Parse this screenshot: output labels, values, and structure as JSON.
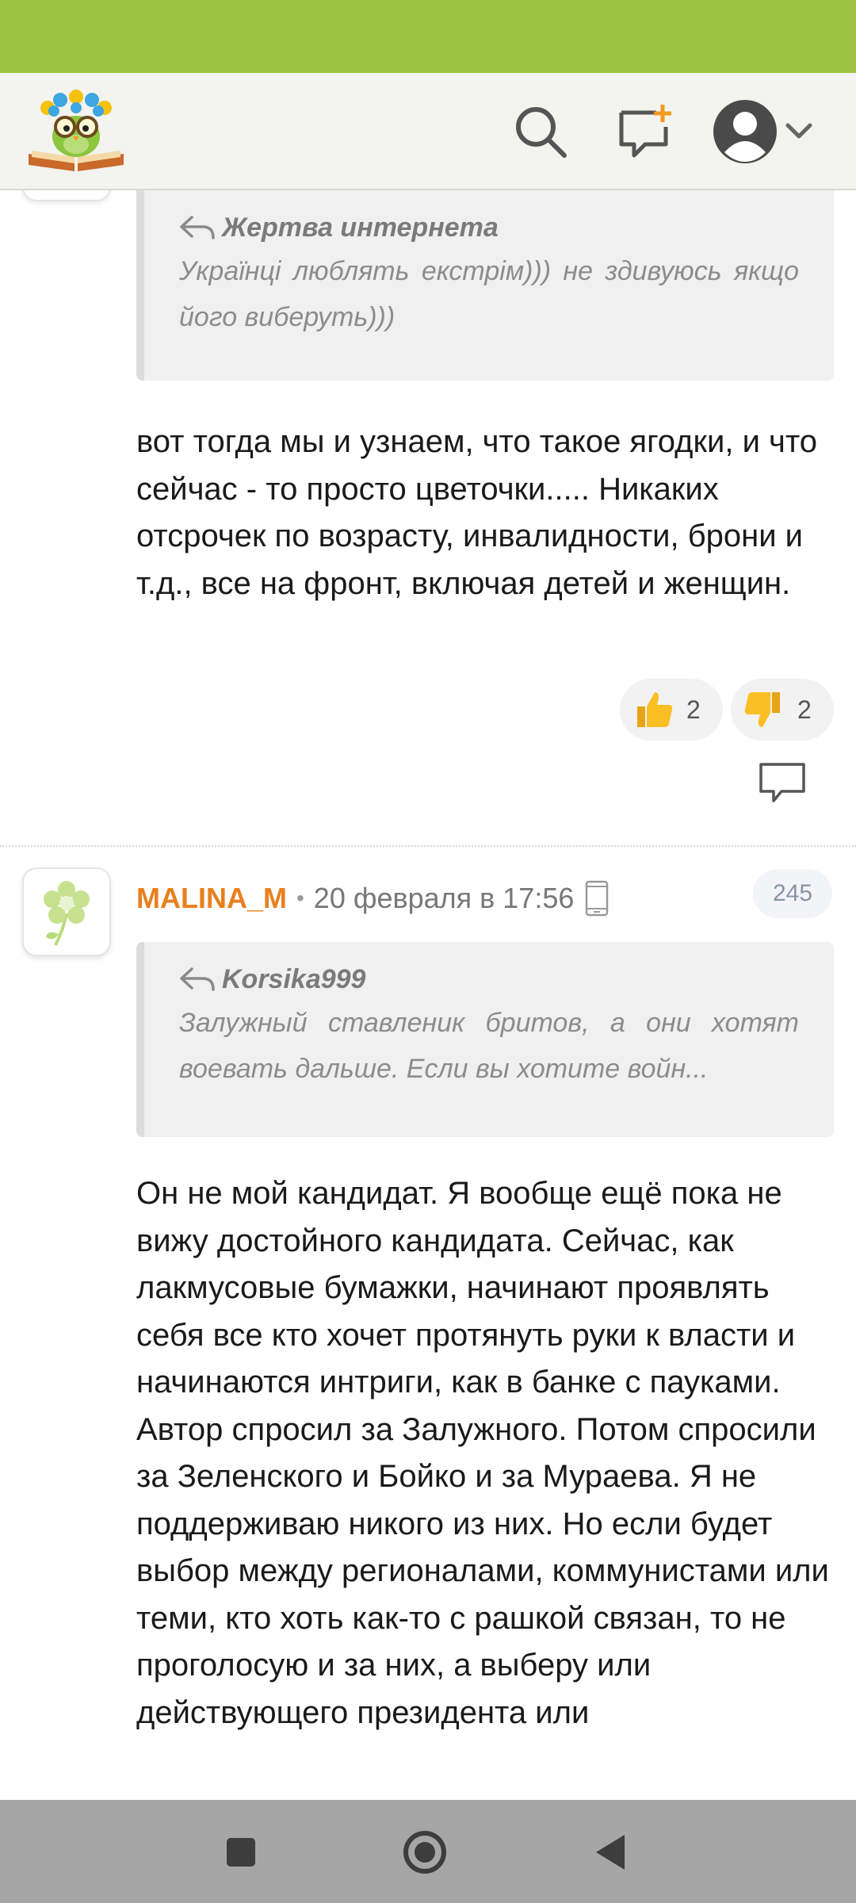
{
  "header": {
    "logo_icon": "owl-glasses-book-logo",
    "search_icon": "search-icon",
    "new_post_icon": "add-comment-icon",
    "profile_icon": "user-avatar-icon"
  },
  "comments": [
    {
      "quote": {
        "author": "Жертва интернета",
        "text": "Українці люблять екстрім))) не здивуюсь якщо його виберуть)))"
      },
      "text": "вот тогда мы и узнаем, что такое ягодки, и что сейчас - то просто цветочки..... Никаких отсрочек по возрасту, инвалидности, брони и т.д., все на фронт, включая детей и женщин.",
      "likes": "2",
      "dislikes": "2"
    },
    {
      "username": "MALINA_M",
      "date": "20 февраля в 17:56",
      "rating": "245",
      "quote": {
        "author": "Korsika999",
        "text": "Залужный ставленик бритов, а они хотят воевать дальше. Если вы хотите войн..."
      },
      "paragraph1": "Он не мой кандидат. Я вообще ещё пока не вижу достойного кандидата. Сейчас, как лакмусовые бумажки, начинают проявлять себя все кто хочет протянуть руки к власти и начинаются интриги, как в банке с пауками.",
      "paragraph2": "Автор спросил за Залужного. Потом спросили за Зеленского и Бойко и за Мураева. Я не поддерживаю никого из них. Но если будет выбор между регионалами, коммунистами или теми, кто хоть как-то с рашкой связан, то не проголосую и за них, а выберу или действующего президента или"
    }
  ],
  "colors": {
    "status_bar": "#9dc244",
    "username": "#e8801e",
    "header_bg": "#f3f3ef"
  }
}
